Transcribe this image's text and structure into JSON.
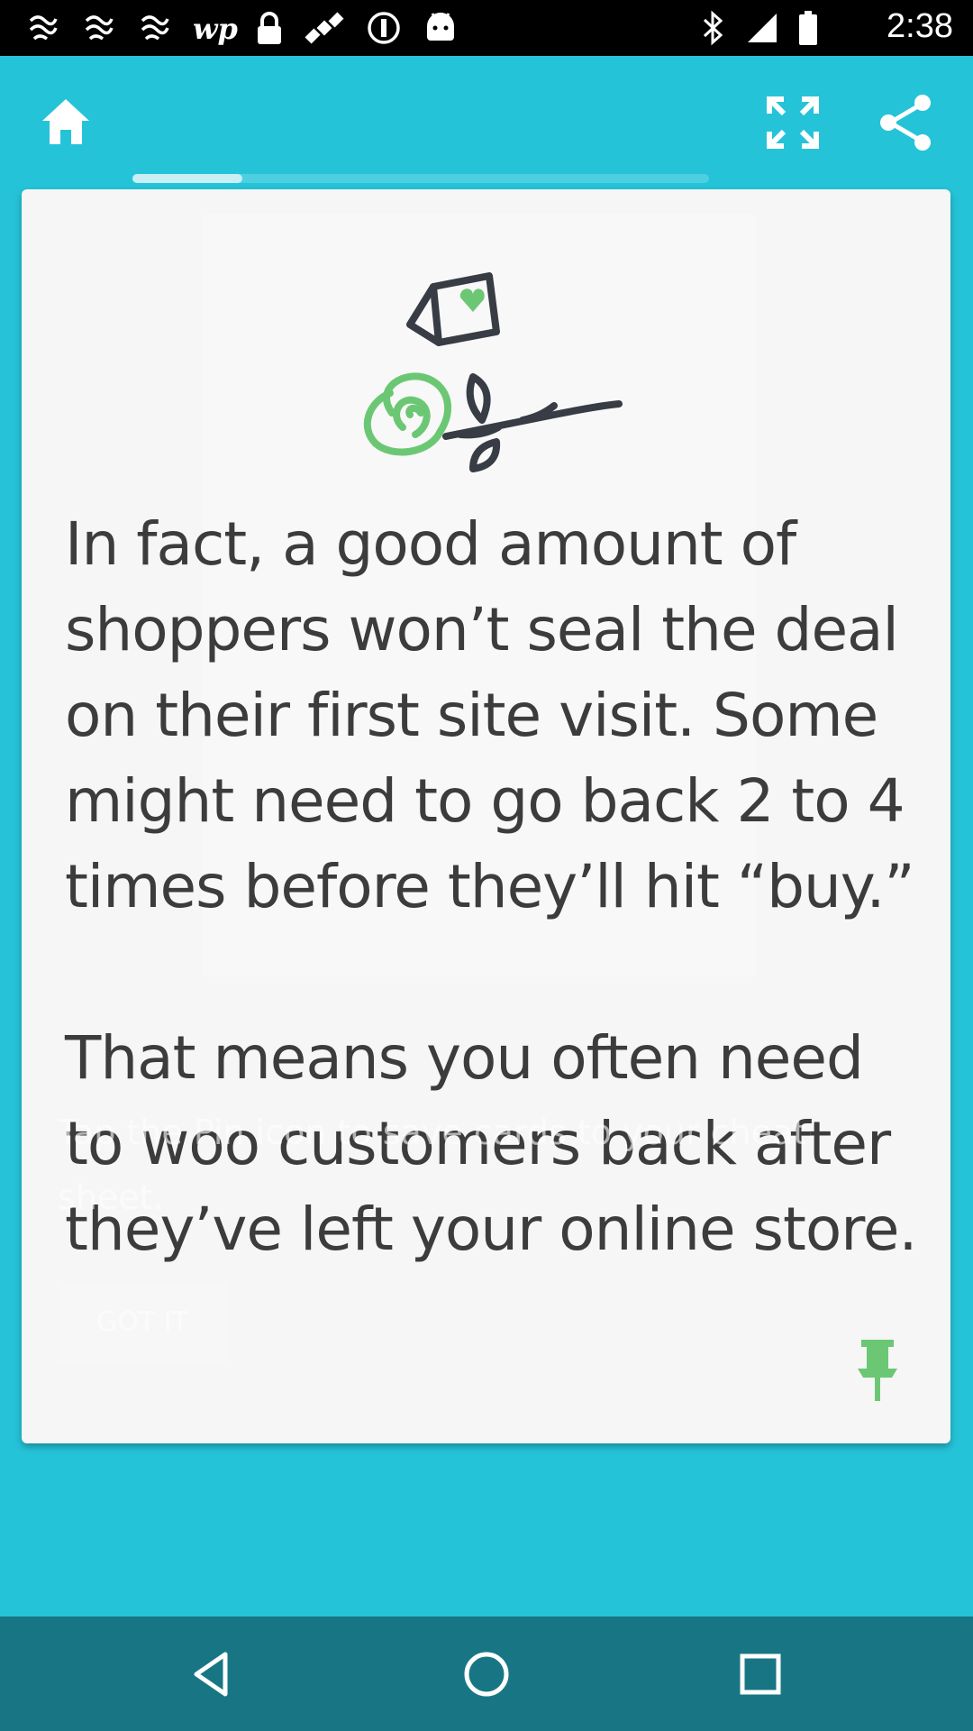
{
  "status_bar": {
    "time": "2:38",
    "icons": [
      "notification-icon",
      "notification-icon",
      "notification-icon",
      "wp-icon",
      "lock-icon",
      "satellite-icon",
      "info-icon",
      "android-icon",
      "bluetooth-icon",
      "signal-icon",
      "battery-icon"
    ]
  },
  "toolbar": {
    "icons": [
      "home-icon",
      "fullscreen-icon",
      "share-icon"
    ],
    "progress": 0.19
  },
  "card": {
    "paragraphs": [
      "In fact, a good amount of shoppers won’t seal the deal on their first site visit. Some might need to go back 2 to 4 times before they’ll hit “buy.”",
      "That means you often need to woo customers back after they’ve left your online store."
    ],
    "illustration": "card-and-rose-illustration",
    "pin_icon": "pin-icon"
  },
  "overlay": {
    "tip_text": "Tap the Pin icon to save cards to your cheat sheet.",
    "got_it_label": "GOT IT"
  },
  "nav_bar": {
    "icons": [
      "back-icon",
      "home-circle-icon",
      "recents-icon"
    ]
  },
  "colors": {
    "background": "#25c3d8",
    "card": "#f6f6f6",
    "text": "#3c3c3c",
    "accent_green": "#6cc774",
    "nav_bar": "#187684",
    "illustration_dark": "#383c44"
  }
}
